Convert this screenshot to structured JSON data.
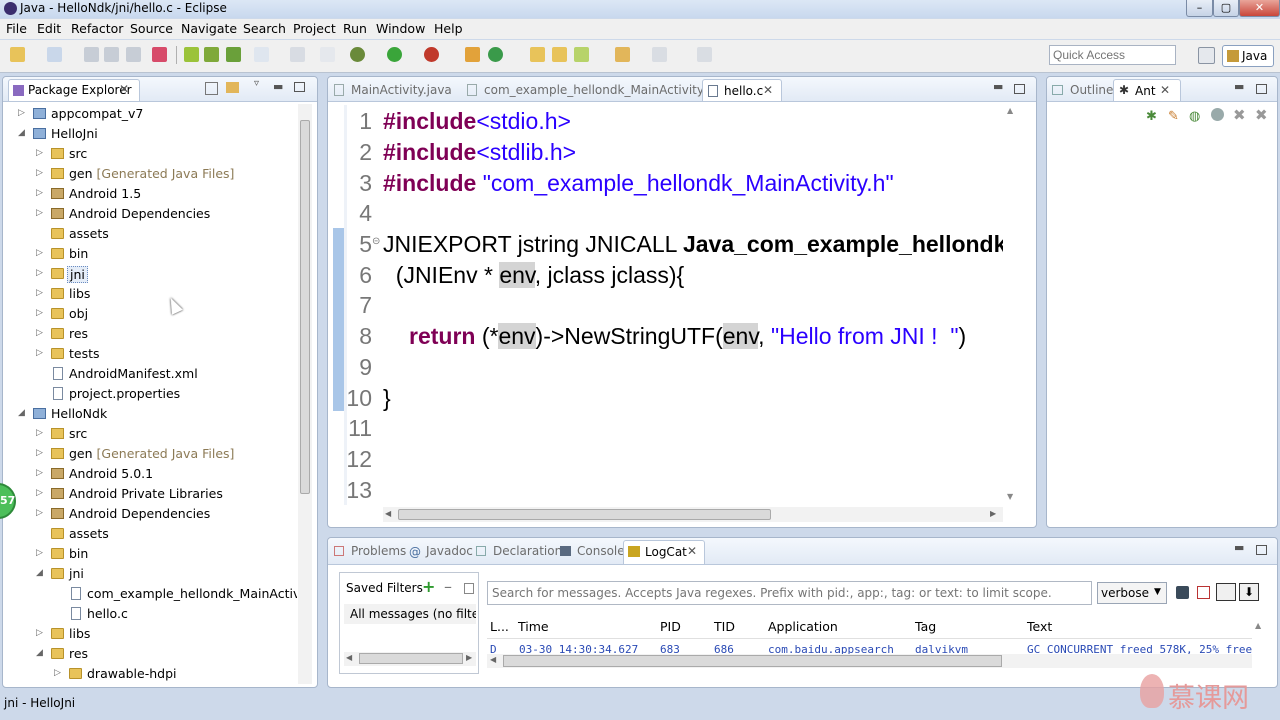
{
  "window": {
    "title": "Java - HelloNdk/jni/hello.c - Eclipse"
  },
  "menu": [
    "File",
    "Edit",
    "Refactor",
    "Source",
    "Navigate",
    "Search",
    "Project",
    "Run",
    "Window",
    "Help"
  ],
  "toolbar": {
    "quick_access_placeholder": "Quick Access",
    "perspective_label": "Java"
  },
  "package_explorer": {
    "tab_label": "Package Explorer",
    "items": [
      {
        "label": "appcompat_v7",
        "suffix": ""
      },
      {
        "label": "HelloJni",
        "suffix": ""
      },
      {
        "label": "src",
        "suffix": ""
      },
      {
        "label": "gen",
        "suffix": "[Generated Java Files]"
      },
      {
        "label": "Android 1.5",
        "suffix": ""
      },
      {
        "label": "Android Dependencies",
        "suffix": ""
      },
      {
        "label": "assets",
        "suffix": ""
      },
      {
        "label": "bin",
        "suffix": ""
      },
      {
        "label": "jni",
        "suffix": ""
      },
      {
        "label": "libs",
        "suffix": ""
      },
      {
        "label": "obj",
        "suffix": ""
      },
      {
        "label": "res",
        "suffix": ""
      },
      {
        "label": "tests",
        "suffix": ""
      },
      {
        "label": "AndroidManifest.xml",
        "suffix": ""
      },
      {
        "label": "project.properties",
        "suffix": ""
      },
      {
        "label": "HelloNdk",
        "suffix": ""
      },
      {
        "label": "src",
        "suffix": ""
      },
      {
        "label": "gen",
        "suffix": "[Generated Java Files]"
      },
      {
        "label": "Android 5.0.1",
        "suffix": ""
      },
      {
        "label": "Android Private Libraries",
        "suffix": ""
      },
      {
        "label": "Android Dependencies",
        "suffix": ""
      },
      {
        "label": "assets",
        "suffix": ""
      },
      {
        "label": "bin",
        "suffix": ""
      },
      {
        "label": "jni",
        "suffix": ""
      },
      {
        "label": "com_example_hellondk_MainActivity.h",
        "suffix": ""
      },
      {
        "label": "hello.c",
        "suffix": ""
      },
      {
        "label": "libs",
        "suffix": ""
      },
      {
        "label": "res",
        "suffix": ""
      },
      {
        "label": "drawable-hdpi",
        "suffix": ""
      }
    ]
  },
  "editor": {
    "tabs": [
      "MainActivity.java",
      "com_example_hellondk_MainActivity.h",
      "hello.c"
    ],
    "line_numbers": [
      "1",
      "2",
      "3",
      "4",
      "5",
      "6",
      "7",
      "8",
      "9",
      "10",
      "11",
      "12",
      "13"
    ],
    "lines": {
      "l1_kw": "#include",
      "l1_rest": "<stdio.h>",
      "l2_kw": "#include",
      "l2_rest": "<stdlib.h>",
      "l3_kw": "#include",
      "l3_str": " \"com_example_hellondk_MainActivity.h\"",
      "l5_a": "JNIEXPORT jstring JNICALL ",
      "l5_b": "Java_com_example_hellondk",
      "l6_a": "  (JNIEnv * ",
      "l6_env": "env",
      "l6_b": ", jclass jclass){",
      "l8_kw": "return",
      "l8_a": " (*",
      "l8_env": "env",
      "l8_b": ")->NewStringUTF(",
      "l8_env2": "env",
      "l8_c": ", ",
      "l8_str": "\"Hello from JNI !  \"",
      "l8_d": ")",
      "l10": "}"
    }
  },
  "outline_panel": {
    "tabs": [
      "Outline",
      "Ant"
    ]
  },
  "bottom_panel": {
    "tabs": [
      "Problems",
      "Javadoc",
      "Declaration",
      "Console",
      "LogCat"
    ],
    "saved_filters_label": "Saved Filters",
    "filter_item": "All messages (no filters)",
    "search_placeholder": "Search for messages. Accepts Java regexes. Prefix with pid:, app:, tag: or text: to limit scope.",
    "level": "verbose",
    "columns": [
      "L...",
      "Time",
      "PID",
      "TID",
      "Application",
      "Tag",
      "Text"
    ],
    "rows": [
      [
        "D",
        "03-30 14:30:34.627",
        "683",
        "686",
        "com.baidu.appsearch",
        "dalvikvm",
        "GC_CONCURRENT freed 578K, 25% free"
      ]
    ]
  },
  "statusbar": {
    "text": "jni - HelloJni",
    "badge": "57",
    "watermark": "慕课网"
  },
  "colors": {
    "accent": "#7f0055",
    "string": "#2a00ff",
    "logcat_text": "#2a4ab5"
  }
}
